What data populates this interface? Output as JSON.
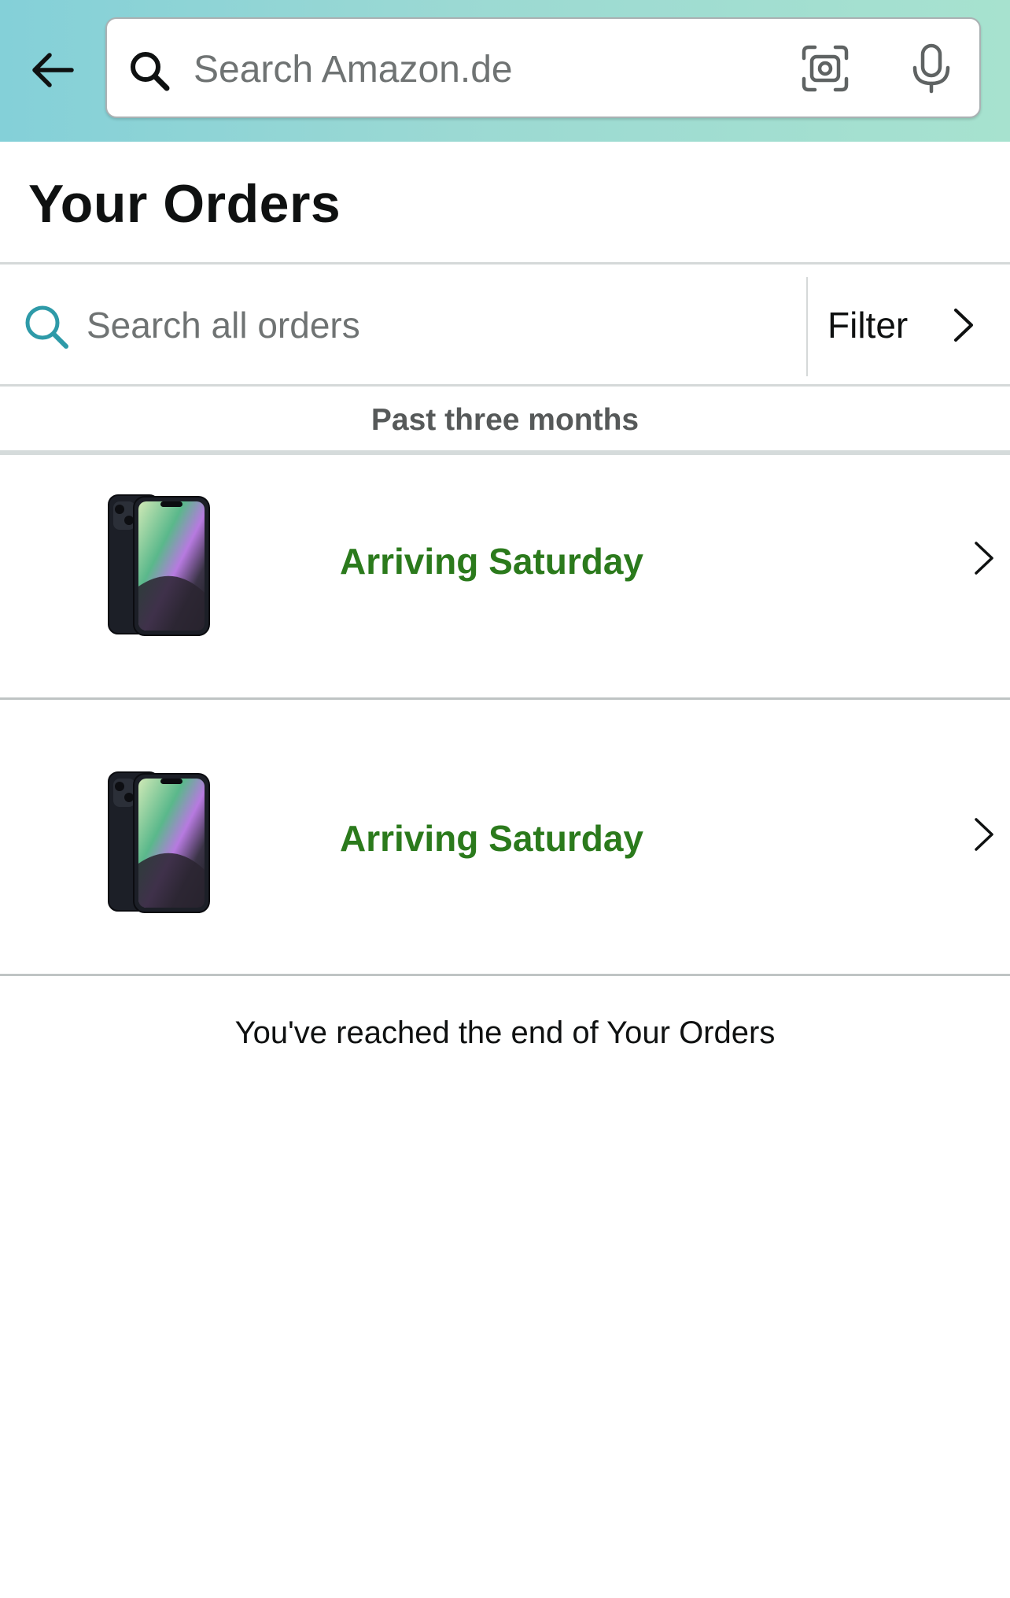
{
  "header": {
    "search_placeholder": "Search Amazon.de",
    "icons": [
      "back-arrow-icon",
      "search-icon",
      "camera-scan-icon",
      "microphone-icon"
    ],
    "background_gradient": [
      "#84d0d8",
      "#a7e2cf"
    ]
  },
  "page": {
    "title": "Your Orders"
  },
  "orders_search": {
    "placeholder": "Search all orders",
    "icon_color": "#2e9aa8"
  },
  "filter": {
    "label": "Filter"
  },
  "section": {
    "label": "Past three months"
  },
  "orders": [
    {
      "status": "Arriving Saturday",
      "product_image": "iphone-midnight-image"
    },
    {
      "status": "Arriving Saturday",
      "product_image": "iphone-midnight-image"
    }
  ],
  "status_color": "#2b7a1c",
  "end_message": "You've reached the end of Your Orders"
}
